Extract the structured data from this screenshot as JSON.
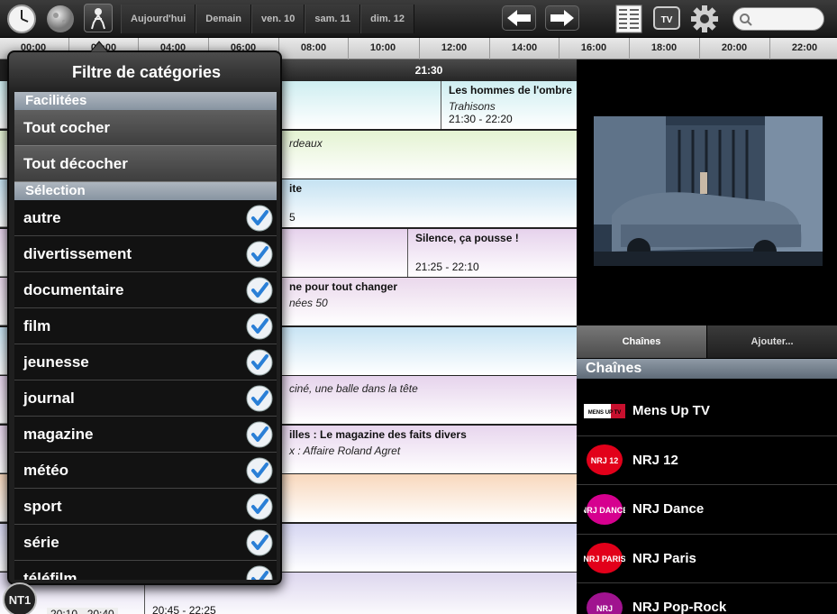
{
  "topbar": {
    "day_tabs": [
      "Aujourd'hui",
      "Demain",
      "ven. 10",
      "sam. 11",
      "dim. 12"
    ],
    "search": {
      "placeholder": "",
      "value": ""
    }
  },
  "timeline": {
    "ticks": [
      "00:00",
      "02:00",
      "04:00",
      "06:00",
      "08:00",
      "10:00",
      "12:00",
      "14:00",
      "16:00",
      "18:00",
      "20:00",
      "22:00"
    ]
  },
  "grid": {
    "now_label": "21:30",
    "rows": [
      {
        "color": "#cfeef1",
        "cells": [
          {
            "title": "",
            "sub": "",
            "hours": ""
          },
          {
            "title": "Les hommes de l'ombre",
            "sub": "Trahisons",
            "hours": "21:30 - 22:20"
          }
        ]
      },
      {
        "color": "#e4f3d2",
        "cells": [
          {
            "title": "",
            "sub": "rdeaux",
            "hours": ""
          }
        ]
      },
      {
        "color": "#c5e2f2",
        "cells": [
          {
            "title": "ite",
            "sub": "",
            "hours": "5"
          }
        ]
      },
      {
        "color": "#e6d2ec",
        "cells": [
          {
            "title": "",
            "sub": "",
            "hours": ""
          },
          {
            "title": "Silence, ça pousse !",
            "sub": "",
            "hours": "21:25 - 22:10"
          }
        ]
      },
      {
        "color": "#ead8ec",
        "cells": [
          {
            "title": "ne pour tout changer",
            "sub": "nées 50",
            "hours": ""
          }
        ]
      },
      {
        "color": "#c8e4f4",
        "cells": [
          {
            "title": "",
            "sub": "",
            "hours": ""
          }
        ]
      },
      {
        "color": "#e6d3ec",
        "cells": [
          {
            "title": "",
            "sub": "ciné, une balle dans la tête",
            "hours": ""
          }
        ]
      },
      {
        "color": "#e8d6ee",
        "cells": [
          {
            "title": "illes : Le magazine des faits divers",
            "sub": "x : Affaire Roland Agret",
            "hours": ""
          }
        ]
      },
      {
        "color": "#f8d8bd",
        "cells": [
          {
            "title": "",
            "sub": "",
            "hours": ""
          }
        ]
      },
      {
        "color": "#d6d6f2",
        "cells": [
          {
            "title": "",
            "sub": "",
            "hours": ""
          }
        ]
      },
      {
        "color": "#ddd6ee",
        "cells": [
          {
            "title": "",
            "sub": "",
            "hours": "20:45 - 22:25"
          }
        ]
      }
    ],
    "bottom_left_hours": "20:10 - 20:40"
  },
  "popover": {
    "title": "Filtre de catégories",
    "section_facilities": "Facilitées",
    "check_all": "Tout cocher",
    "uncheck_all": "Tout décocher",
    "section_selection": "Sélection",
    "categories": [
      {
        "label": "autre",
        "checked": true
      },
      {
        "label": "divertissement",
        "checked": true
      },
      {
        "label": "documentaire",
        "checked": true
      },
      {
        "label": "film",
        "checked": true
      },
      {
        "label": "jeunesse",
        "checked": true
      },
      {
        "label": "journal",
        "checked": true
      },
      {
        "label": "magazine",
        "checked": true
      },
      {
        "label": "météo",
        "checked": true
      },
      {
        "label": "sport",
        "checked": true
      },
      {
        "label": "série",
        "checked": true
      },
      {
        "label": "téléfilm",
        "checked": true
      }
    ]
  },
  "right_panel": {
    "tabs": {
      "channels": "Chaînes",
      "add": "Ajouter..."
    },
    "channels_header": "Chaînes",
    "channels": [
      {
        "name": "Mens Up TV",
        "logo_text": "MENS UP TV",
        "logo_color": "#c8102e"
      },
      {
        "name": "NRJ 12",
        "logo_text": "NRJ 12",
        "logo_color": "#e2001a"
      },
      {
        "name": "NRJ Dance",
        "logo_text": "NRJ DANCE",
        "logo_color": "#d6008f"
      },
      {
        "name": "NRJ Paris",
        "logo_text": "NRJ PARIS",
        "logo_color": "#e2001a"
      },
      {
        "name": "NRJ Pop-Rock",
        "logo_text": "NRJ",
        "logo_color": "#a0138f"
      }
    ]
  },
  "colors": {
    "accent_check": "#2a7fd6",
    "section_header": "#9aa6b2"
  }
}
